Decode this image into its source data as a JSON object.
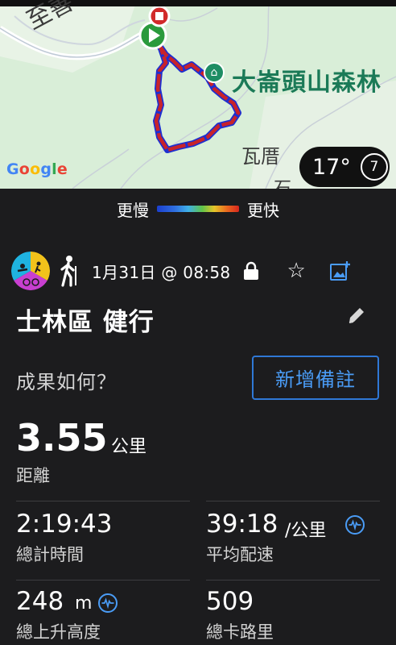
{
  "map": {
    "park_label": "大崙頭山森林",
    "town_label": "瓦厝",
    "partial_label": "石",
    "road_label": "至善",
    "google_label": "Google",
    "weather": {
      "temperature": "17°",
      "wind_speed": "7"
    }
  },
  "pace_legend": {
    "slower": "更慢",
    "faster": "更快"
  },
  "activity": {
    "date": "1月31日 @ 08:58",
    "title": "士林區 健行",
    "notes_prompt": "成果如何？",
    "add_note_button": "新增備註",
    "distance": {
      "value": "3.55",
      "unit": "公里",
      "label": "距離"
    },
    "stats": {
      "total_time": {
        "value": "2:19:43",
        "label": "總計時間"
      },
      "avg_pace": {
        "value": "39:18",
        "unit": "/公里",
        "label": "平均配速"
      },
      "elevation_gain": {
        "value": "248",
        "unit": "m",
        "label": "總上升高度"
      },
      "calories": {
        "value": "509",
        "label": "總卡路里"
      }
    }
  },
  "colors": {
    "accent": "#4a9cf6",
    "route": "#c8232a",
    "park": "#1b7a57",
    "background": "#1c1c1e"
  }
}
